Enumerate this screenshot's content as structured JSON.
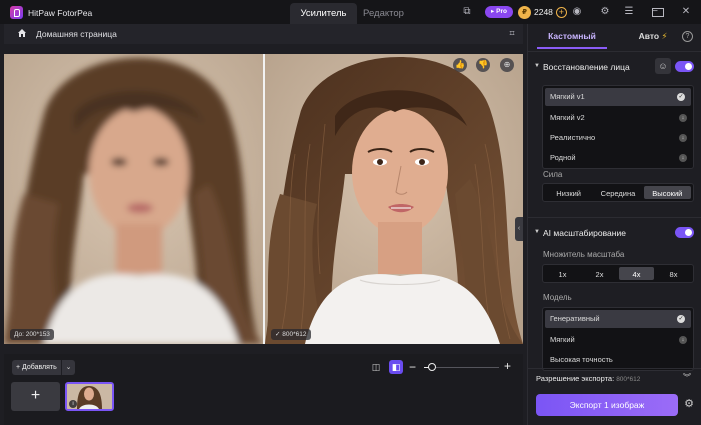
{
  "app": {
    "name": "HitPaw FotorPea",
    "tabs": [
      "Усилитель",
      "Редактор"
    ],
    "pro_label": "Pro",
    "credits": "2248",
    "credit_coin_glyph": "₽"
  },
  "workspace": {
    "breadcrumb": "Домашняя страница",
    "before_size": "До: 200*153",
    "after_size": "800*612",
    "add_label": "Добавлять"
  },
  "panel": {
    "tabs": {
      "custom": "Кастомный",
      "auto": "Авто"
    },
    "face": {
      "title": "Восстановление лица",
      "enabled": true,
      "models": [
        {
          "label": "Мягкий v1",
          "state": "selected"
        },
        {
          "label": "Мягкий v2",
          "state": "download"
        },
        {
          "label": "Реалистично",
          "state": "download"
        },
        {
          "label": "Родной",
          "state": "download"
        }
      ],
      "strength_label": "Сила",
      "strength_options": [
        "Низкий",
        "Середина",
        "Высокий"
      ],
      "strength_selected": "Высокий"
    },
    "upscale": {
      "title": "AI масштабирование",
      "enabled": true,
      "factor_label": "Множитель масштаба",
      "factors": [
        "1x",
        "2x",
        "4x",
        "8x"
      ],
      "factor_selected": "4x",
      "model_label": "Модель",
      "models": [
        {
          "label": "Генеративный",
          "state": "selected"
        },
        {
          "label": "Мягкий",
          "state": "download"
        },
        {
          "label": "Высокая точность",
          "state": "none"
        }
      ]
    },
    "export": {
      "resolution_label": "Разрешение экспорта:",
      "resolution_value": "800*612",
      "button_label": "Экспорт 1 изображ"
    }
  },
  "colors": {
    "accent": "#7a55f5",
    "background": "#1e1e23"
  }
}
